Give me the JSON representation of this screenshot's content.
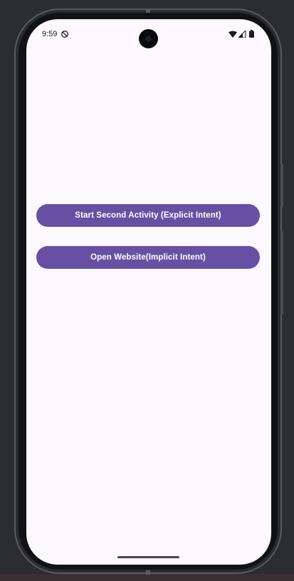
{
  "status_bar": {
    "time": "9:59",
    "icons": [
      "do-not-disturb-icon",
      "wifi-icon",
      "signal-icon",
      "battery-icon"
    ]
  },
  "main": {
    "buttons": [
      {
        "label": "Start Second Activity (Explicit Intent)"
      },
      {
        "label": "Open Website(Implicit Intent)"
      }
    ]
  },
  "colors": {
    "screen_background": "#fdf7ff",
    "button_background": "#6750a4",
    "button_text": "#ffffff",
    "frame": "#111214",
    "desktop_background": "#2b2d31"
  }
}
